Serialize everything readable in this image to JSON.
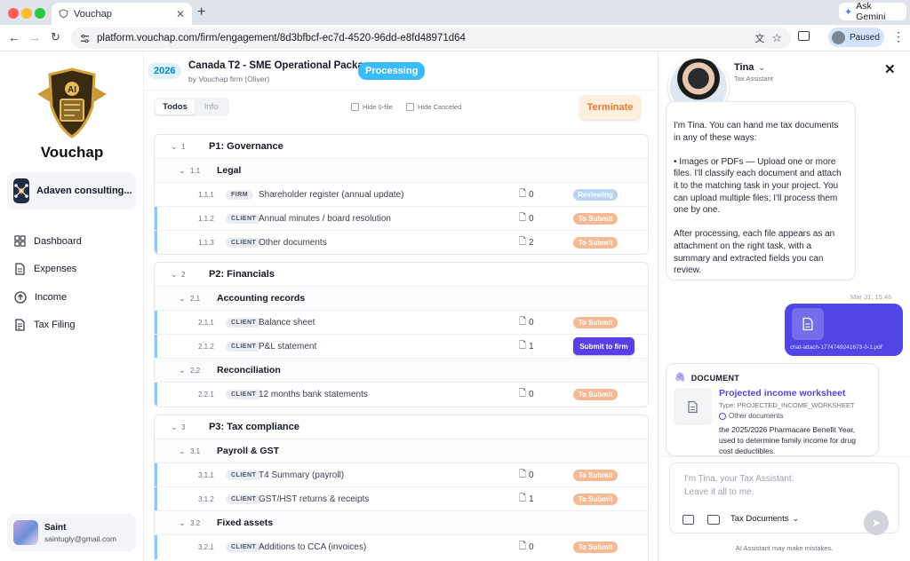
{
  "browser": {
    "tab_title": "Vouchap",
    "url": "platform.vouchap.com/firm/engagement/8d3bfbcf-ec7d-4520-96dd-e8fd48971d64",
    "ask_gemini": "Ask Gemini",
    "profile_status": "Paused"
  },
  "sidebar": {
    "brand": "Vouchap",
    "org_name": "Adaven consulting...",
    "nav": [
      {
        "label": "Dashboard",
        "icon": "grid-icon"
      },
      {
        "label": "Expenses",
        "icon": "document-icon"
      },
      {
        "label": "Income",
        "icon": "arrow-up-circle-icon"
      },
      {
        "label": "Tax Filing",
        "icon": "file-text-icon"
      }
    ],
    "user": {
      "name": "Saint",
      "email": "saintugly@gmail.com"
    }
  },
  "header": {
    "year": "2026",
    "title": "Canada T2 - SME Operational Package",
    "subtitle": "by Vouchap firm (Oliver)",
    "status": "Processing",
    "tabs": [
      "Todos",
      "Info"
    ],
    "hide_0_file": "Hide 0-file",
    "hide_canceled": "Hide Canceled",
    "terminate": "Terminate"
  },
  "sections": [
    {
      "num": "1",
      "title": "P1: Governance",
      "subs": [
        {
          "num": "1.1",
          "title": "Legal",
          "items": [
            {
              "num": "1.1.1",
              "tag": "FIRM",
              "name": "Shareholder register (annual update)",
              "files": "0",
              "status": "Reviewing"
            },
            {
              "num": "1.1.2",
              "tag": "CLIENT",
              "name": "Annual minutes / board resolution",
              "files": "0",
              "status": "To Submit"
            },
            {
              "num": "1.1.3",
              "tag": "CLIENT",
              "name": "Other documents",
              "files": "2",
              "status": "To Submit"
            }
          ]
        }
      ]
    },
    {
      "num": "2",
      "title": "P2: Financials",
      "subs": [
        {
          "num": "2.1",
          "title": "Accounting records",
          "items": [
            {
              "num": "2.1.1",
              "tag": "CLIENT",
              "name": "Balance sheet",
              "files": "0",
              "status": "To Submit"
            },
            {
              "num": "2.1.2",
              "tag": "CLIENT",
              "name": "P&L statement",
              "files": "1",
              "status": "Submit to firm"
            }
          ]
        },
        {
          "num": "2.2",
          "title": "Reconciliation",
          "items": [
            {
              "num": "2.2.1",
              "tag": "CLIENT",
              "name": "12 months bank statements",
              "files": "0",
              "status": "To Submit"
            }
          ]
        }
      ]
    },
    {
      "num": "3",
      "title": "P3: Tax compliance",
      "subs": [
        {
          "num": "3.1",
          "title": "Payroll & GST",
          "items": [
            {
              "num": "3.1.1",
              "tag": "CLIENT",
              "name": "T4 Summary (payroll)",
              "files": "0",
              "status": "To Submit"
            },
            {
              "num": "3.1.2",
              "tag": "CLIENT",
              "name": "GST/HST returns & receipts",
              "files": "1",
              "status": "To Submit"
            }
          ]
        },
        {
          "num": "3.2",
          "title": "Fixed assets",
          "items": [
            {
              "num": "3.2.1",
              "tag": "CLIENT",
              "name": "Additions to CCA (invoices)",
              "files": "0",
              "status": "To Submit"
            }
          ]
        }
      ]
    }
  ],
  "chat": {
    "assistant_name": "Tina",
    "assistant_role": "Tax Assistant",
    "intro_lines": [
      "I'm Tina. You can hand me tax documents",
      "in any of these ways:",
      "",
      "• Images or PDFs — Upload one or more",
      "files. I'll classify each document and attach",
      "it to the matching task in your project. You",
      "can upload multiple files; I'll process them",
      "one by one.",
      "",
      "After processing, each file appears as an",
      "attachment on the right task, with a",
      "summary and extracted fields you can",
      "review."
    ],
    "timestamp": "Mar 31, 15:46",
    "attachment_name": "chat-attach-1774749241673-0-1.pdf",
    "doc_card": {
      "header": "DOCUMENT",
      "title": "Projected income worksheet",
      "type": "Type: PROJECTED_INCOME_WORKSHEET",
      "category": "Other documents",
      "description_lines": [
        "the 2025/2026 Pharmacare Benefit Year,",
        "used to determine family income for drug",
        "cost deductibles."
      ]
    },
    "input_placeholder_1": "I'm Tina, your Tax Assistant.",
    "input_placeholder_2": "Leave it all to me.",
    "doc_type_select": "Tax Documents",
    "disclaimer": "AI Assistant may make mistakes."
  },
  "colors": {
    "accent": "#5a3ee6",
    "processing": "#38bdf8",
    "to_submit": "#f6b993",
    "reviewing": "#b9d3f5",
    "user_bubble": "#4f46e5"
  }
}
